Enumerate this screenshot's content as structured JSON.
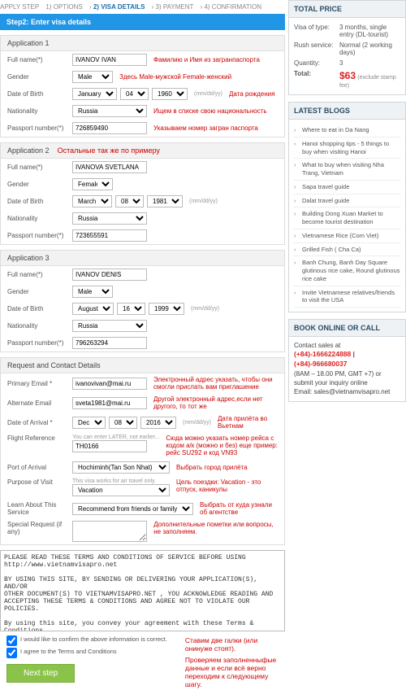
{
  "steps": {
    "label": "APPLY STEP",
    "s1": "1) OPTIONS",
    "s2": "2) VISA DETAILS",
    "s3": "3) PAYMENT",
    "s4": "4) CONFIRMATION"
  },
  "barTitle": "Step2: Enter visa details",
  "labels": {
    "fullname": "Full name(*)",
    "gender": "Gender",
    "dob": "Date of Birth",
    "nat": "Nationality",
    "pass": "Passport number(*)"
  },
  "dmy": "(mm/dd/yy)",
  "app1": {
    "title": "Application 1",
    "name": "IVANOV IVAN",
    "gender": "Male",
    "dobM": "January",
    "dobD": "04",
    "dobY": "1960",
    "nat": "Russia",
    "pass": "726859490",
    "a_name": "Фамилию и Имя из загранпаспорта",
    "a_gender": "Здесь Male-мужской Female-женский",
    "a_dob": "Дата рождения",
    "a_nat": "Ищем в списке свою национальность",
    "a_pass": "Указываем номер загран паспорта"
  },
  "app2": {
    "title": "Application 2",
    "note": "Остальные так же по примеру",
    "name": "IVANOVA SVETLANA",
    "gender": "Female",
    "dobM": "March",
    "dobD": "08",
    "dobY": "1981",
    "nat": "Russia",
    "pass": "723655591"
  },
  "app3": {
    "title": "Application 3",
    "name": "IVANOV DENIS",
    "gender": "Male",
    "dobM": "August",
    "dobD": "16",
    "dobY": "1999",
    "nat": "Russia",
    "pass": "796263294"
  },
  "req": {
    "title": "Request and Contact Details",
    "l_email1": "Primary Email *",
    "v_email1": "ivanovivan@mai.ru",
    "a_email1": "Электронный адрес указать, чтобы они смогли прислать вам приглашение",
    "l_email2": "Alternate Email",
    "v_email2": "sveta1981@mai.ru",
    "a_email2": "Другой электронный адрес,если нет другого, то тот же",
    "l_arr": "Date of Arrival *",
    "v_arrM": "Dec",
    "v_arrD": "08",
    "v_arrY": "2016",
    "a_arr": "Дата прилёта во Вьетнам",
    "l_flight": "Flight Reference",
    "v_flight": "TH0166",
    "h_flight": "You can enter LATER, not earlier...",
    "a_flight": "Сюда можно указать номер рейса с кодом а/к (можно и без) еще пример: рейс SU292 и код VN93",
    "l_port": "Port of Arrival",
    "v_port": "Hochiminh(Tan Son Nhat)",
    "a_port": "Выбрать город прилёта",
    "l_purp": "Purpose of Visit",
    "v_purp": "Vacation",
    "h_purp": "This visa works for air travel only.",
    "a_purp": "Цель поездки: Vacation - это отпуск, каникулы",
    "l_learn": "Learn About This Service",
    "v_learn": "Recommend from friends or family",
    "a_learn": "Выбрать от куда узнали об агентстве",
    "l_spec": "Special Request (if any)",
    "a_spec": "Дополнительные пометки или вопросы, не заполняем."
  },
  "tc_text": "PLEASE READ THESE TERMS AND CONDITIONS OF SERVICE BEFORE USING\nhttp://www.vietnamvisapro.net\n\nBY USING THIS SITE, BY SENDING OR DELIVERING YOUR APPLICATION(S), AND/OR\nOTHER DOCUMENT(S) TO VIETNAMVISAPRO.NET , YOU ACKNOWLEDGE READING AND\nACCEPTING THESE TERMS & CONDITIONS AND AGREE NOT TO VIOLATE OUR POLICIES.\n\nBy using this site, you convey your agreement with these Terms & Conditions\nand the Privacy Statement. If you do not agree with the terms stated in this",
  "ck1": "I would like to confirm the above information is correct.",
  "ck2": "I agree to the Terms and Conditions",
  "btn_next": "Next step",
  "a_bottom1": "Ставим две галки (или онинуже стоят).",
  "a_bottom2": "Проверяем заполненныфые данные и если всё верно переходим к следующему шагу.",
  "price": {
    "head": "TOTAL PRICE",
    "l_type": "Visa of type:",
    "v_type": "3 months, single entry (DL-tourist)",
    "l_rush": "Rush service:",
    "v_rush": "Normal (2 working days)",
    "l_qty": "Quantity:",
    "v_qty": "3",
    "l_total": "Total:",
    "v_total": "$63",
    "fee": "(exclude stamp fee)"
  },
  "blogs": {
    "head": "LATEST BLOGS",
    "items": [
      "Where to eat in Da Nang",
      "Hanoi shopping tips - 5 things to buy when visiting Hanoi",
      "What to buy when visiting Nha Trang, Vietnam",
      "Sapa travel guide",
      "Dalat travel guide",
      "Building Dong Xuan Market to become tourist destination",
      "Vietnamese Rice (Com Viet)",
      "Grilled Fish ( Cha Ca)",
      "Banh Chung, Banh Day Square glutinous rice cake, Round glutinous rice cake",
      "Invite Vietnamese relatives/friends to visit the USA"
    ]
  },
  "book": {
    "head": "BOOK ONLINE OR CALL",
    "contact": "Contact sales at",
    "phones": "(+84)-1666224888 | (+84)-966680037",
    "hours": "(8AM – 18.00 PM, GMT +7) or submit your inquiry online",
    "email": "Email: sales@vietnamvisapro.net"
  }
}
